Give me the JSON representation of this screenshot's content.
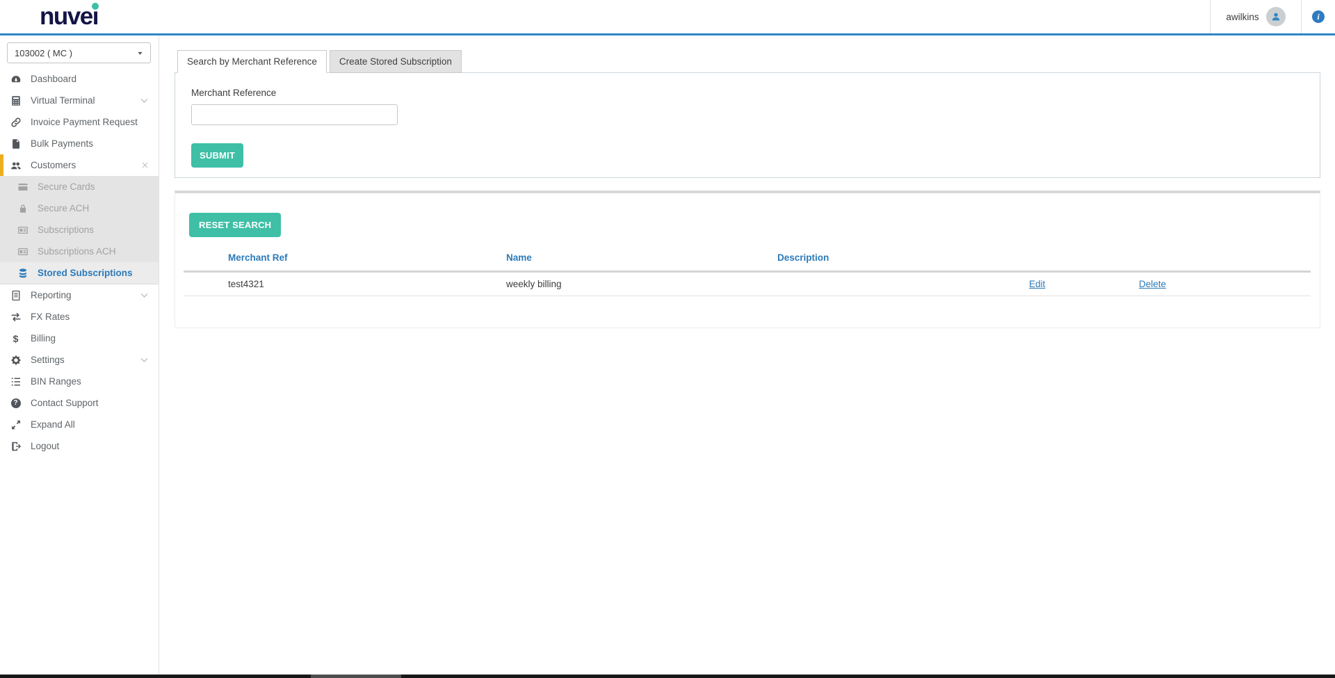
{
  "header": {
    "logo": "nuvei",
    "username": "awilkins",
    "user_icon": "person",
    "info_icon": "info"
  },
  "sidebar": {
    "merchant_select": {
      "value": "103002 ( MC )",
      "caret_icon": "caret-down"
    },
    "items_top": [
      {
        "label": "Dashboard",
        "icon": "dashboard"
      },
      {
        "label": "Virtual Terminal",
        "icon": "calculator",
        "tail_icon": "chevron-down"
      },
      {
        "label": "Invoice Payment Request",
        "icon": "link"
      },
      {
        "label": "Bulk Payments",
        "icon": "file"
      },
      {
        "label": "Customers",
        "icon": "users",
        "tail_icon": "close"
      }
    ],
    "submenu": [
      {
        "label": "Secure Cards",
        "icon": "credit-card"
      },
      {
        "label": "Secure ACH",
        "icon": "lock"
      },
      {
        "label": "Subscriptions",
        "icon": "subscription"
      },
      {
        "label": "Subscriptions ACH",
        "icon": "subscription"
      },
      {
        "label": "Stored Subscriptions",
        "icon": "database",
        "active": true
      }
    ],
    "items_bottom": [
      {
        "label": "Reporting",
        "icon": "report",
        "tail_icon": "chevron-down"
      },
      {
        "label": "FX Rates",
        "icon": "exchange"
      },
      {
        "label": "Billing",
        "icon": "dollar"
      },
      {
        "label": "Settings",
        "icon": "gears",
        "tail_icon": "chevron-down"
      },
      {
        "label": "BIN Ranges",
        "icon": "list"
      },
      {
        "label": "Contact Support",
        "icon": "question"
      },
      {
        "label": "Expand All",
        "icon": "expand"
      },
      {
        "label": "Logout",
        "icon": "logout"
      }
    ]
  },
  "main": {
    "tabs": [
      {
        "label": "Search by Merchant Reference",
        "active": true
      },
      {
        "label": "Create Stored Subscription",
        "active": false
      }
    ],
    "search_form": {
      "label": "Merchant Reference",
      "input_value": "",
      "submit_label": "SUBMIT"
    },
    "results": {
      "reset_label": "RESET SEARCH",
      "columns": [
        "Merchant Ref",
        "Name",
        "Description"
      ],
      "rows": [
        {
          "merchant_ref": "test4321",
          "name": "weekly billing",
          "description": "",
          "edit_label": "Edit",
          "delete_label": "Delete"
        }
      ]
    }
  },
  "colors": {
    "accent_teal": "#3EBFA6",
    "link_blue": "#2B7AB9",
    "header_border_blue": "#2E86C5",
    "active_item_yellow": "#EDAE1F",
    "logo_navy": "#151447",
    "submenu_grey": "#E4E4E4"
  }
}
